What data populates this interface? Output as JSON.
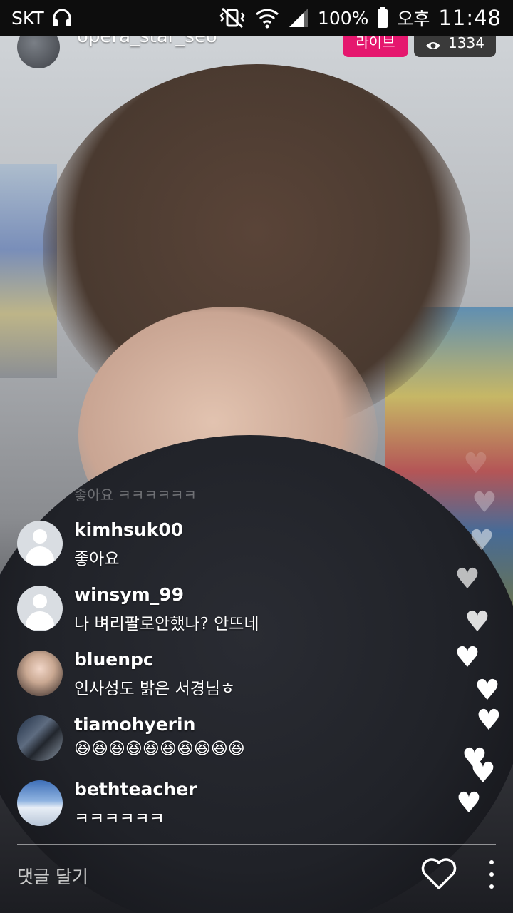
{
  "status_bar": {
    "carrier": "SKT",
    "battery": "100%",
    "ampm": "오후",
    "time": "11:48",
    "icons": [
      "headphones-icon",
      "vibrate-off-icon",
      "wifi-icon",
      "signal-icon",
      "battery-icon"
    ]
  },
  "stream": {
    "host_name": "opera_star_seo",
    "live_label": "라이브",
    "viewer_count": "1334",
    "ghost_comment": "좋아요 ㅋㅋㅋㅋㅋㅋ"
  },
  "comments": [
    {
      "user": "kimhsuk00",
      "text": "좋아요",
      "avatar": "default"
    },
    {
      "user": "winsym_99",
      "text": "나 벼리팔로안했나? 안뜨네",
      "avatar": "default"
    },
    {
      "user": "bluenpc",
      "text": "인사성도 밝은 서경님ㅎ",
      "avatar": "photo"
    },
    {
      "user": "tiamohyerin",
      "text": "😆😆😆😆😆😆😆😆😆😆",
      "avatar": "photo"
    },
    {
      "user": "bethteacher",
      "text": "ㅋㅋㅋㅋㅋㅋ",
      "avatar": "photo"
    }
  ],
  "bottom_bar": {
    "comment_placeholder": "댓글 달기"
  },
  "colors": {
    "live_badge": "#e5176e",
    "viewer_badge": "#3a3a3a",
    "status_bar": "#0d0d0d"
  }
}
